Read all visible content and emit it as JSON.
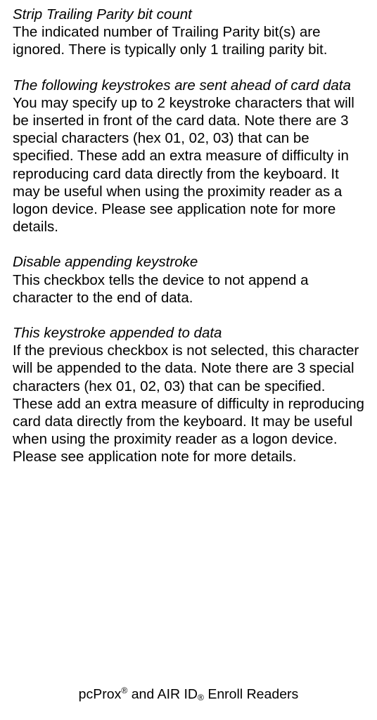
{
  "sections": {
    "s1": {
      "heading": "Strip Trailing Parity bit count",
      "body": "The indicated number of Trailing Parity bit(s) are ignored. There is typically only 1 trailing parity bit."
    },
    "s2": {
      "heading": "The following keystrokes are sent ahead of card data",
      "body": "You may specify up to 2 keystroke characters that will be inserted in front of the card data. Note there are 3 special characters (hex 01, 02, 03) that can be specified. These add an extra measure of difficulty in reproducing card data directly from the keyboard. It may be useful when using the proximity reader as a logon device. Please see application note for more details."
    },
    "s3": {
      "heading": "Disable appending keystroke",
      "body": "This checkbox tells the device to not append a character to the end of data."
    },
    "s4": {
      "heading": "This keystroke appended to data",
      "body": "If the previous checkbox is not selected, this character will be appended to the data. Note there are 3 special characters (hex 01, 02, 03) that can be specified. These add an extra measure of difficulty in reproducing card data directly from the keyboard. It may be useful when using the proximity reader as a logon device. Please see application note for more details."
    }
  },
  "footer": {
    "prefix": "pcProx",
    "sup": "®",
    "mid": " and AIR ID",
    "sub": "®",
    "suffix": " Enroll Readers"
  }
}
